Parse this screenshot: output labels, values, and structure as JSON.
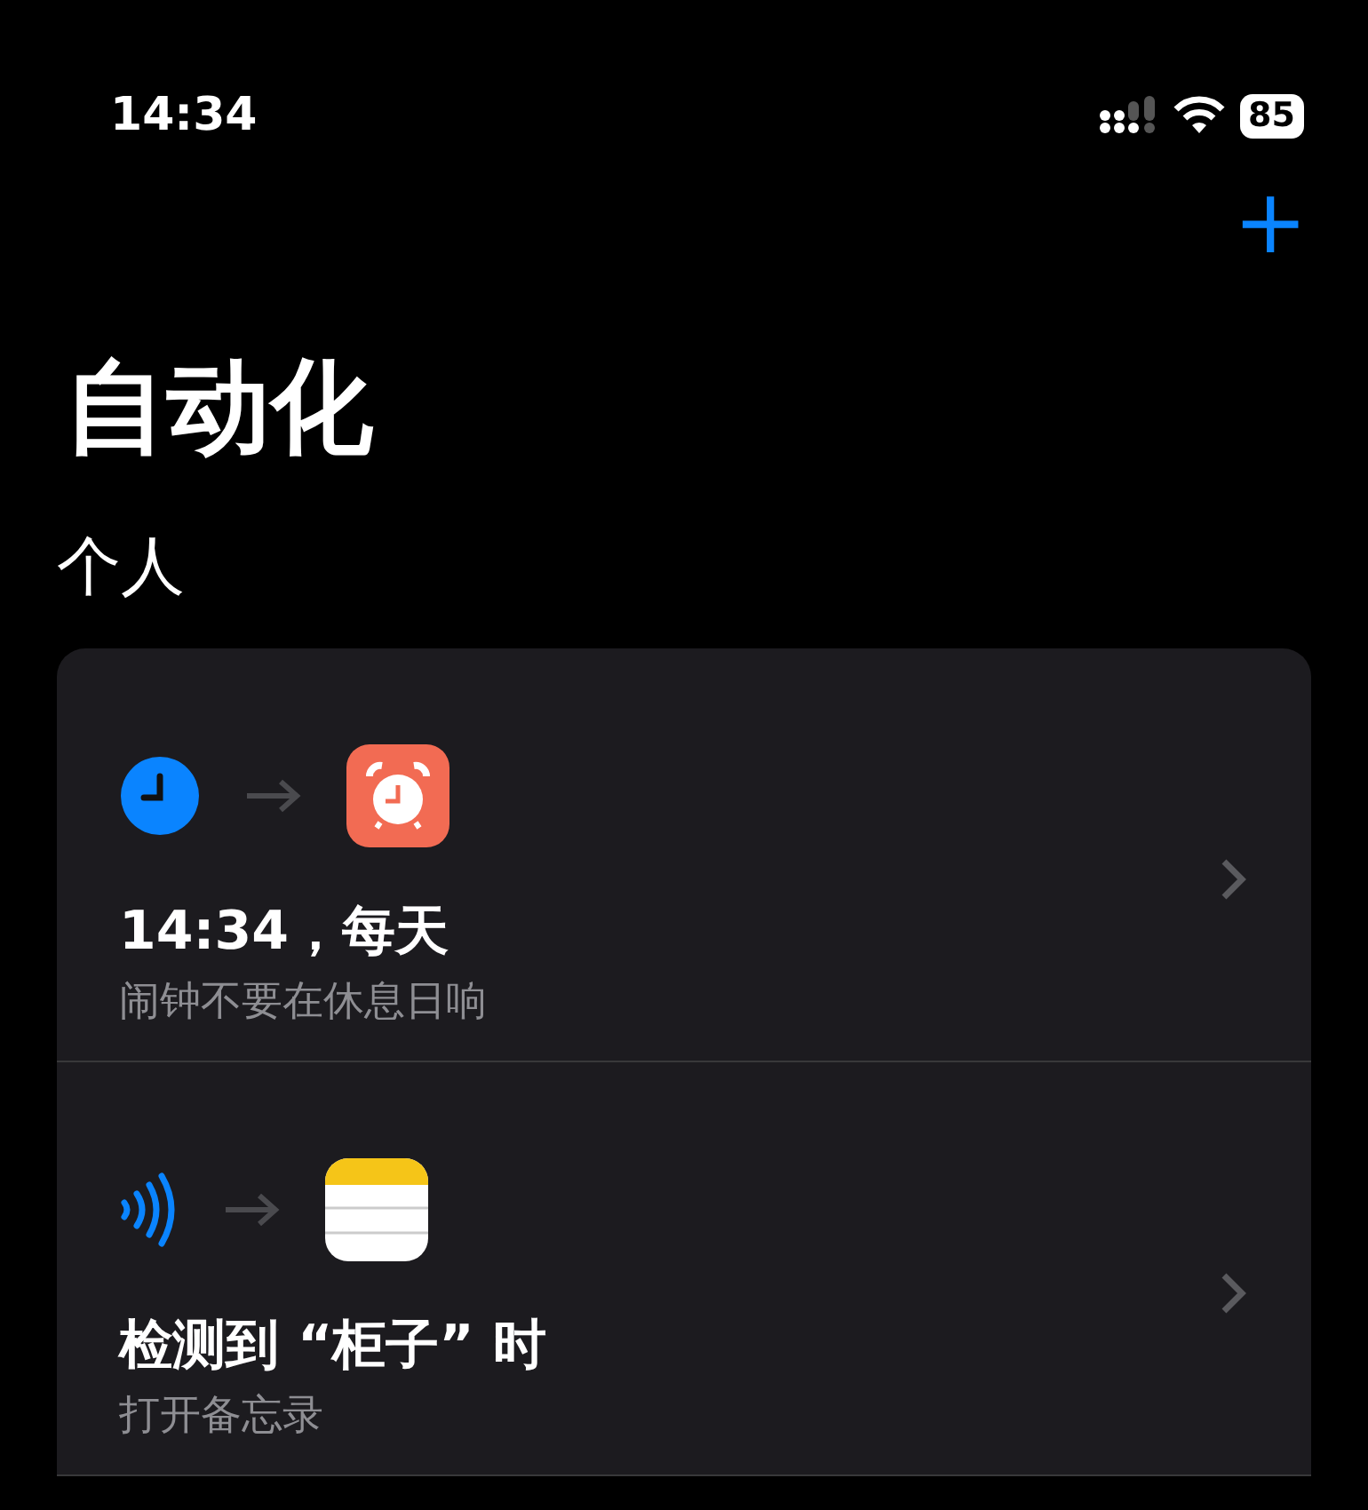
{
  "status_bar": {
    "time": "14:34",
    "battery": "85"
  },
  "add_button": "+",
  "title": "自动化",
  "section": "个人",
  "automations": [
    {
      "trigger": {
        "kind": "time"
      },
      "action": {
        "kind": "alarm"
      },
      "title": "14:34，每天",
      "subtitle": "闹钟不要在休息日响"
    },
    {
      "trigger": {
        "kind": "nfc"
      },
      "action": {
        "kind": "notes"
      },
      "title": "检测到 “柜子” 时",
      "subtitle": "打开备忘录"
    }
  ]
}
